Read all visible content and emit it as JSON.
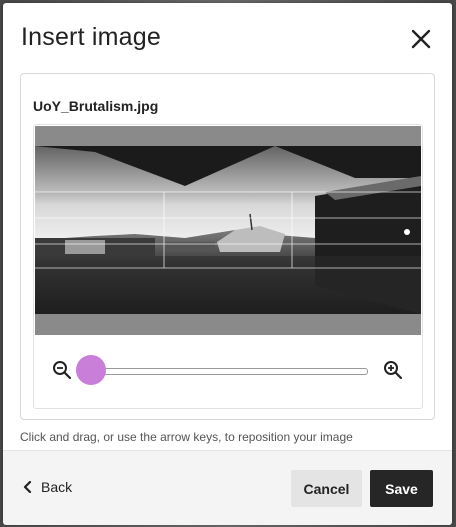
{
  "dialog": {
    "title": "Insert image",
    "close_icon": "close-icon"
  },
  "panel": {
    "filename": "UoY_Brutalism.jpg",
    "zoom": {
      "out_icon": "zoom-out-icon",
      "in_icon": "zoom-in-icon",
      "level": 0.0
    }
  },
  "hint": "Click and drag, or use the arrow keys, to reposition your image",
  "footer": {
    "back_label": "Back",
    "back_icon": "chevron-left-icon",
    "cancel_label": "Cancel",
    "save_label": "Save"
  },
  "colors": {
    "slider_thumb": "#c97ed9",
    "save_button": "#262626",
    "cancel_button": "#e4e4e4"
  }
}
